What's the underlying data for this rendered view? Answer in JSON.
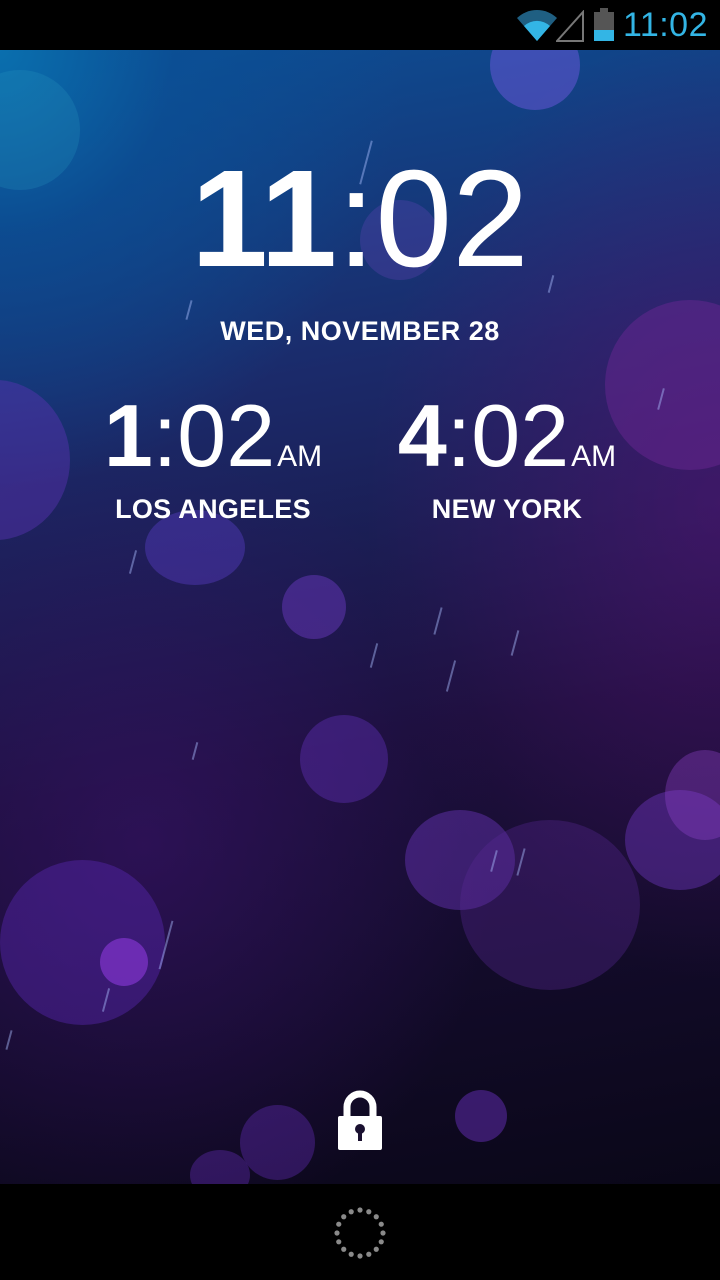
{
  "status_bar": {
    "time": "11:02",
    "accent_color": "#33b5e5",
    "icons": [
      "wifi-icon",
      "signal-icon",
      "battery-icon"
    ]
  },
  "lockscreen": {
    "clock": {
      "hours": "11",
      "separator": ":",
      "minutes": "02"
    },
    "date": "WED, NOVEMBER 28",
    "world_clocks": [
      {
        "hours": "1",
        "minutes": ":02",
        "ampm": "AM",
        "city": "LOS ANGELES"
      },
      {
        "hours": "4",
        "minutes": ":02",
        "ampm": "AM",
        "city": "NEW YORK"
      }
    ],
    "lock_icon": "lock-icon"
  },
  "nav_bar": {
    "icon": "loading-spinner-icon"
  }
}
